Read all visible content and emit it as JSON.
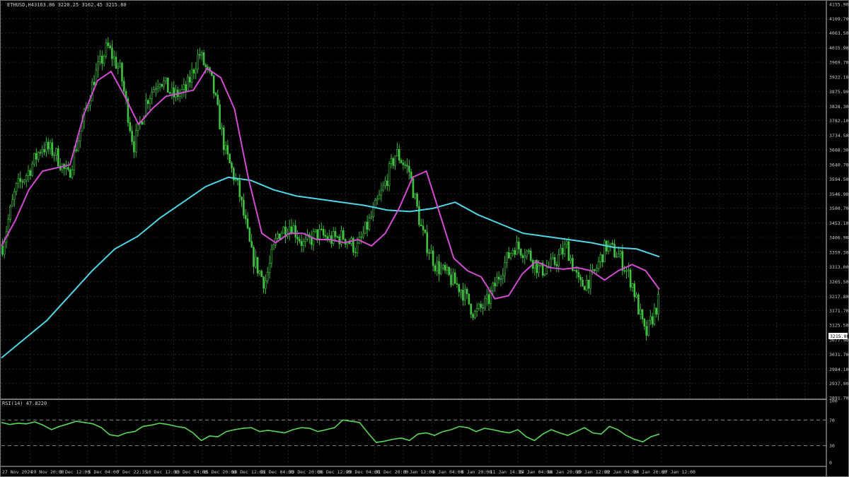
{
  "header": {
    "symbol": "ETHUSD,H4",
    "ohlc": "3163.86 3220.25 3162.45 3215.80"
  },
  "current_price": "3215.80",
  "rsi_header": "RSI(14) 47.8220",
  "colors": {
    "background": "#000000",
    "grid": "#3a3a3a",
    "candle": "#3fc43f",
    "ma_fast": "#d34ad3",
    "ma_slow": "#4fd6e6",
    "rsi": "#58d858"
  },
  "chart_data": [
    {
      "type": "candlestick",
      "title": "ETHUSD,H4",
      "y_ticks": [
        "4155.90",
        "4109.70",
        "4063.50",
        "4015.90",
        "3969.70",
        "3922.10",
        "3875.90",
        "3828.30",
        "3782.10",
        "3734.50",
        "3688.30",
        "3640.70",
        "3594.50",
        "3546.90",
        "3500.70",
        "3453.10",
        "3406.90",
        "3359.30",
        "3313.00",
        "3265.50",
        "3217.80",
        "3171.70",
        "3125.50",
        "3077.90",
        "3031.70",
        "2984.10",
        "2937.90",
        "2891.70"
      ],
      "y_range": [
        2891.7,
        4155.9
      ],
      "x_ticks": [
        "27 Nov 2024",
        "29 Nov 20:00",
        "2 Dec 12:00",
        "5 Dec 04:00",
        "7 Dec 22:35",
        "10 Dec 12:00",
        "13 Dec 04:00",
        "15 Dec 20:00",
        "18 Dec 12:00",
        "21 Dec 04:00",
        "23 Dec 20:00",
        "26 Dec 12:00",
        "29 Dec 04:00",
        "31 Dec 20:00",
        "3 Jan 12:00",
        "6 Jan 04:00",
        "8 Jan 20:00",
        "11 Jan 14:35",
        "14 Jan 04:00",
        "16 Jan 20:00",
        "19 Jan 12:00",
        "22 Jan 04:00",
        "24 Jan 20:00",
        "27 Jan 12:00"
      ],
      "price_anchors": [
        3380,
        3560,
        3620,
        3700,
        3680,
        3600,
        3760,
        3920,
        4020,
        3940,
        3700,
        3850,
        3920,
        3860,
        3880,
        4000,
        3900,
        3680,
        3560,
        3350,
        3260,
        3420,
        3450,
        3380,
        3420,
        3400,
        3410,
        3370,
        3460,
        3560,
        3680,
        3620,
        3420,
        3320,
        3280,
        3240,
        3160,
        3200,
        3300,
        3380,
        3360,
        3300,
        3320,
        3380,
        3250,
        3280,
        3380,
        3350,
        3260,
        3090,
        3200
      ],
      "series": [
        {
          "name": "MA fast",
          "values": [
            3380,
            3460,
            3560,
            3620,
            3630,
            3640,
            3800,
            3910,
            3940,
            3860,
            3770,
            3820,
            3860,
            3870,
            3880,
            3950,
            3920,
            3820,
            3600,
            3420,
            3390,
            3420,
            3420,
            3400,
            3400,
            3390,
            3400,
            3380,
            3420,
            3500,
            3600,
            3620,
            3480,
            3340,
            3300,
            3280,
            3210,
            3220,
            3290,
            3330,
            3310,
            3305,
            3310,
            3300,
            3270,
            3300,
            3320,
            3300,
            3240
          ]
        },
        {
          "name": "MA slow",
          "values": [
            3020,
            3080,
            3140,
            3220,
            3300,
            3370,
            3410,
            3470,
            3520,
            3570,
            3600,
            3590,
            3560,
            3540,
            3530,
            3520,
            3510,
            3495,
            3490,
            3500,
            3520,
            3480,
            3450,
            3420,
            3410,
            3400,
            3390,
            3375,
            3370,
            3345
          ]
        }
      ]
    },
    {
      "type": "line",
      "title": "RSI(14) 47.8220",
      "y_ticks": [
        "100",
        "70",
        "30",
        "0"
      ],
      "y_range": [
        0,
        100
      ],
      "levels": [
        70,
        30
      ],
      "series": [
        {
          "name": "RSI(14)",
          "values": [
            66,
            63,
            65,
            64,
            67,
            62,
            55,
            60,
            64,
            68,
            66,
            64,
            58,
            47,
            45,
            50,
            52,
            60,
            62,
            65,
            63,
            60,
            58,
            50,
            38,
            45,
            44,
            52,
            55,
            57,
            58,
            52,
            54,
            52,
            50,
            55,
            58,
            57,
            52,
            55,
            58,
            70,
            68,
            66,
            50,
            35,
            37,
            40,
            42,
            38,
            48,
            50,
            46,
            52,
            55,
            60,
            58,
            52,
            57,
            55,
            52,
            50,
            55,
            44,
            38,
            48,
            55,
            50,
            46,
            52,
            58,
            50,
            48,
            60,
            55,
            46,
            40,
            36,
            44,
            48
          ]
        }
      ]
    }
  ]
}
